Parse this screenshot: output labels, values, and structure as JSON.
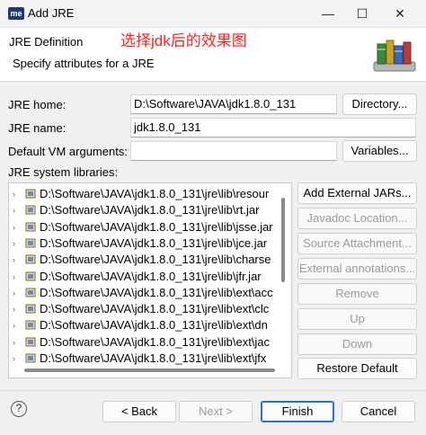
{
  "window": {
    "app_icon_text": "me",
    "title": "Add JRE",
    "minimize": "—",
    "maximize": "☐",
    "close": "✕"
  },
  "header": {
    "title": "JRE Definition",
    "note": "选择jdk后的效果图",
    "description": "Specify attributes for a JRE"
  },
  "form": {
    "jre_home_label": "JRE home:",
    "jre_home_value": "D:\\Software\\JAVA\\jdk1.8.0_131",
    "directory_button": "Directory...",
    "jre_name_label": "JRE name:",
    "jre_name_value": "jdk1.8.0_131",
    "vm_args_label": "Default VM arguments:",
    "vm_args_value": "",
    "variables_button": "Variables...",
    "libraries_label": "JRE system libraries:"
  },
  "libraries": [
    "D:\\Software\\JAVA\\jdk1.8.0_131\\jre\\lib\\resour",
    "D:\\Software\\JAVA\\jdk1.8.0_131\\jre\\lib\\rt.jar",
    "D:\\Software\\JAVA\\jdk1.8.0_131\\jre\\lib\\jsse.jar",
    "D:\\Software\\JAVA\\jdk1.8.0_131\\jre\\lib\\jce.jar",
    "D:\\Software\\JAVA\\jdk1.8.0_131\\jre\\lib\\charse",
    "D:\\Software\\JAVA\\jdk1.8.0_131\\jre\\lib\\jfr.jar",
    "D:\\Software\\JAVA\\jdk1.8.0_131\\jre\\lib\\ext\\acc",
    "D:\\Software\\JAVA\\jdk1.8.0_131\\jre\\lib\\ext\\clc",
    "D:\\Software\\JAVA\\jdk1.8.0_131\\jre\\lib\\ext\\dn",
    "D:\\Software\\JAVA\\jdk1.8.0_131\\jre\\lib\\ext\\jac",
    "D:\\Software\\JAVA\\jdk1.8.0_131\\jre\\lib\\ext\\jfx"
  ],
  "side_buttons": {
    "add_external": "Add External JARs...",
    "javadoc": "Javadoc Location...",
    "source": "Source Attachment...",
    "external_annotations": "External annotations...",
    "remove": "Remove",
    "up": "Up",
    "down": "Down",
    "restore": "Restore Default"
  },
  "footer": {
    "help": "?",
    "back": "< Back",
    "next": "Next >",
    "finish": "Finish",
    "cancel": "Cancel"
  },
  "colors": {
    "note": "#ff2020",
    "focus_border": "#2a6fd6",
    "disabled_text": "#9b9b9b"
  }
}
